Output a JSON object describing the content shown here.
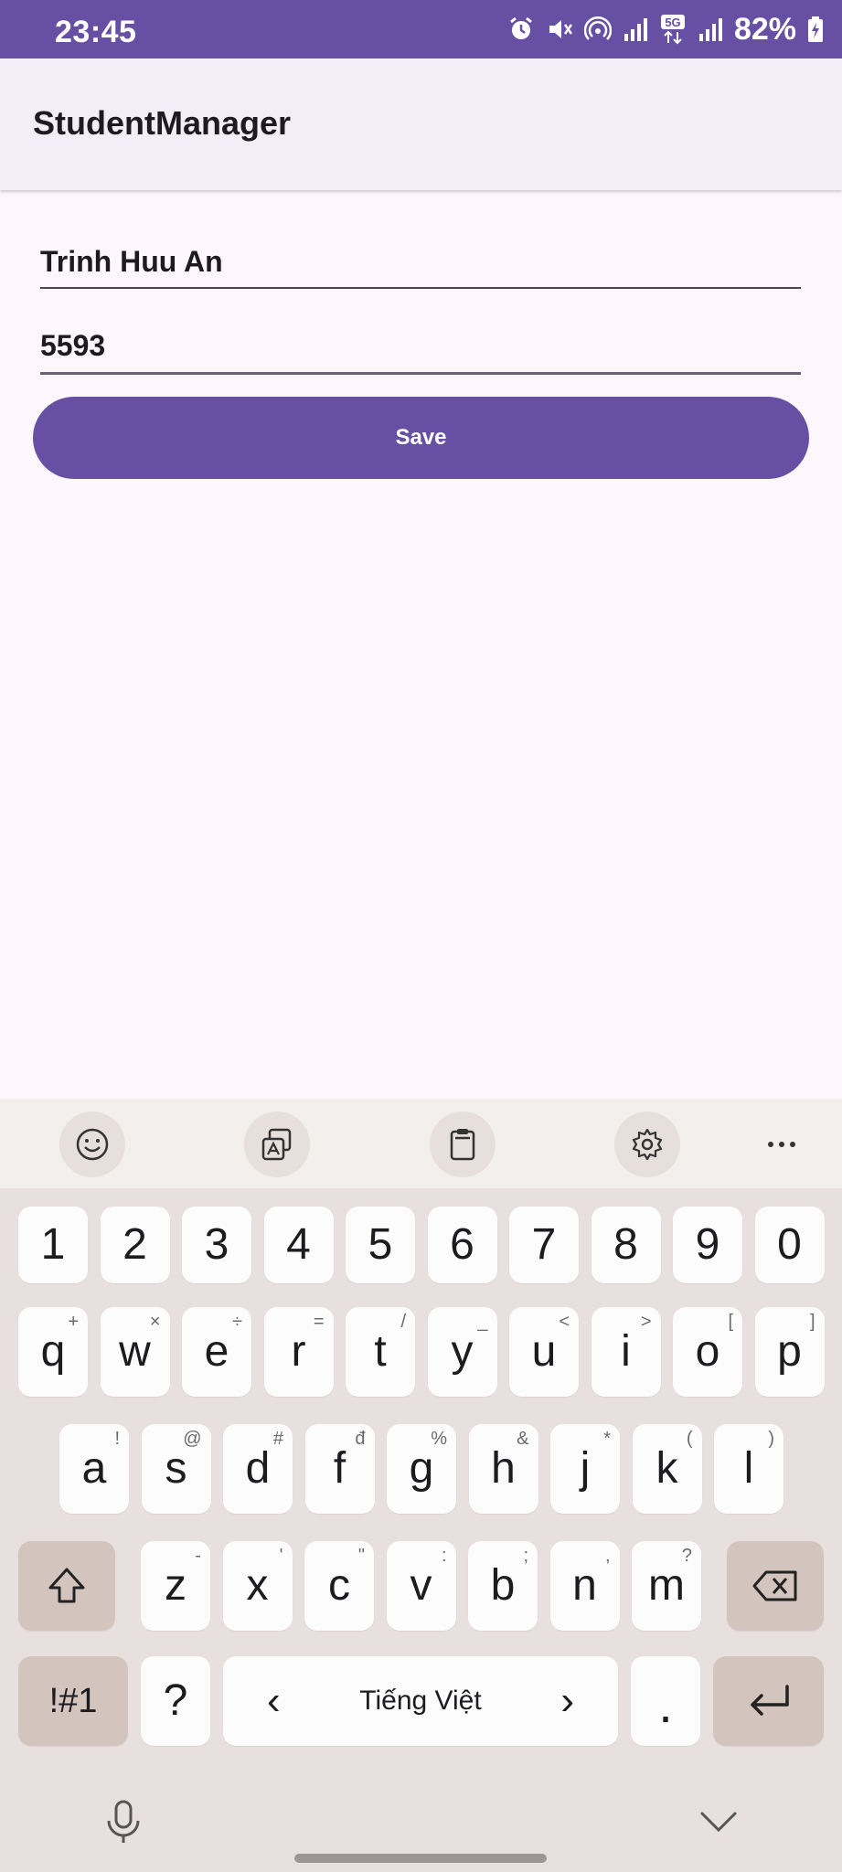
{
  "status_bar": {
    "time": "23:45",
    "battery": "82%",
    "network_label": "5G",
    "icons": [
      "alarm-icon",
      "mute-icon",
      "hotspot-icon",
      "signal-icon",
      "5g-icon",
      "signal-icon",
      "battery-charging-icon"
    ]
  },
  "app_bar": {
    "title": "StudentManager"
  },
  "form": {
    "name_value": "Trinh Huu An",
    "id_value": "5593",
    "save_label": "Save"
  },
  "keyboard": {
    "toolbar": [
      "emoji-icon",
      "translate-icon",
      "clipboard-icon",
      "settings-icon",
      "more-icon"
    ],
    "number_row": [
      "1",
      "2",
      "3",
      "4",
      "5",
      "6",
      "7",
      "8",
      "9",
      "0"
    ],
    "row1": [
      {
        "k": "q",
        "s": "+"
      },
      {
        "k": "w",
        "s": "×"
      },
      {
        "k": "e",
        "s": "÷"
      },
      {
        "k": "r",
        "s": "="
      },
      {
        "k": "t",
        "s": "/"
      },
      {
        "k": "y",
        "s": "_"
      },
      {
        "k": "u",
        "s": "<"
      },
      {
        "k": "i",
        "s": ">"
      },
      {
        "k": "o",
        "s": "["
      },
      {
        "k": "p",
        "s": "]"
      }
    ],
    "row2": [
      {
        "k": "a",
        "s": "!"
      },
      {
        "k": "s",
        "s": "@"
      },
      {
        "k": "d",
        "s": "#"
      },
      {
        "k": "f",
        "s": "đ"
      },
      {
        "k": "g",
        "s": "%"
      },
      {
        "k": "h",
        "s": "&"
      },
      {
        "k": "j",
        "s": "*"
      },
      {
        "k": "k",
        "s": "("
      },
      {
        "k": "l",
        "s": ")"
      }
    ],
    "row3": [
      {
        "k": "z",
        "s": "-"
      },
      {
        "k": "x",
        "s": "'"
      },
      {
        "k": "c",
        "s": "\""
      },
      {
        "k": "v",
        "s": ":"
      },
      {
        "k": "b",
        "s": ";"
      },
      {
        "k": "n",
        "s": ","
      },
      {
        "k": "m",
        "s": "?"
      }
    ],
    "symbols_label": "!#1",
    "question_label": "?",
    "space_label": "Tiếng Việt",
    "space_left": "‹",
    "space_right": "›",
    "period_label": "."
  },
  "colors": {
    "primary": "#6750a4",
    "app_bar_bg": "#f3edf7",
    "surface": "#fdf7fc",
    "keyboard_bg": "#e8e0de",
    "key_dark": "#d3c5bd"
  }
}
